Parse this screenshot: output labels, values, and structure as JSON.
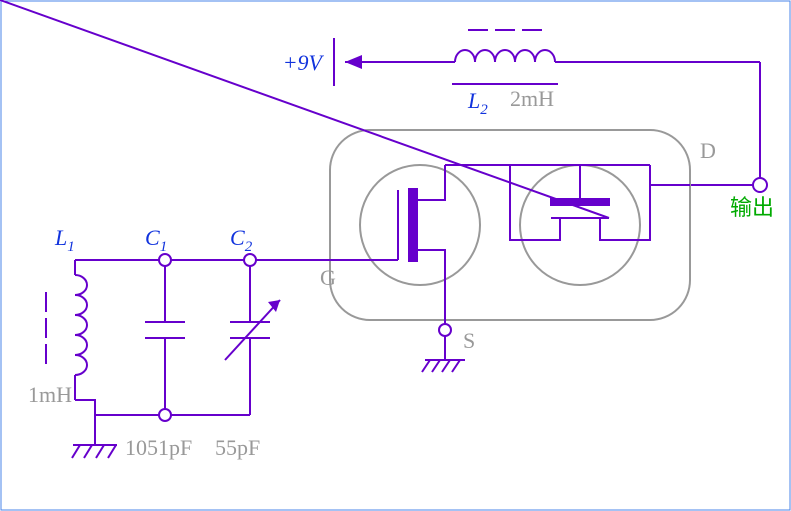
{
  "chart_data": {
    "type": "circuit-schematic",
    "supply": {
      "label": "+9V"
    },
    "components": [
      {
        "ref": "L1",
        "type": "inductor-tunable",
        "value": "1mH",
        "label": "L",
        "sub": "1"
      },
      {
        "ref": "C1",
        "type": "capacitor",
        "value": "1051pF",
        "label": "C",
        "sub": "1"
      },
      {
        "ref": "C2",
        "type": "capacitor-variable",
        "value": "55pF",
        "label": "C",
        "sub": "2"
      },
      {
        "ref": "L2",
        "type": "inductor-tunable",
        "value": "2mH",
        "label": "L",
        "sub": "2"
      },
      {
        "ref": "Q1",
        "type": "cascode-fet-pair",
        "pins": {
          "G": "G",
          "S": "S",
          "D": "D"
        }
      }
    ],
    "output": {
      "label": "输出"
    }
  },
  "labels": {
    "supply": "+9V",
    "L1": "L",
    "L1_sub": "1",
    "L1_val": "1mH",
    "C1": "C",
    "C1_sub": "1",
    "C1_val": "1051pF",
    "C2": "C",
    "C2_sub": "2",
    "C2_val": "55pF",
    "L2": "L",
    "L2_sub": "2",
    "L2_val": "2mH",
    "G": "G",
    "S": "S",
    "D": "D",
    "out": "输出"
  }
}
